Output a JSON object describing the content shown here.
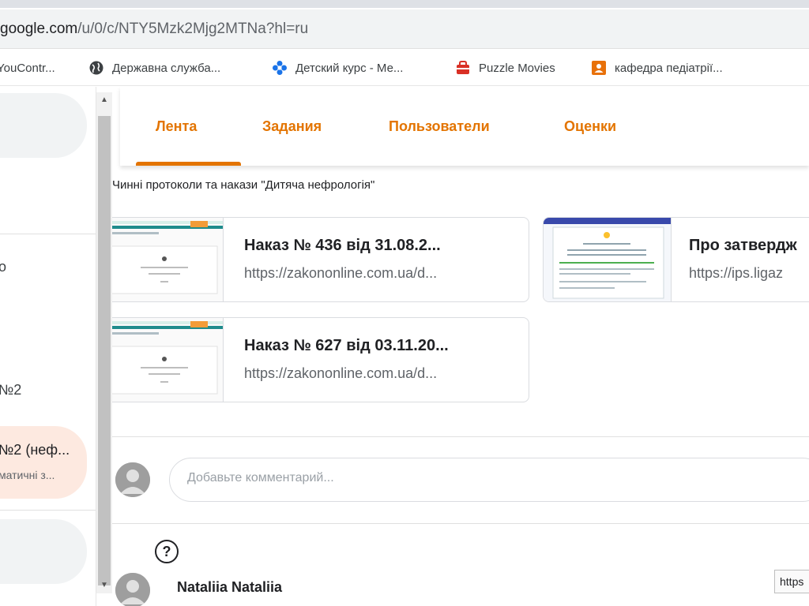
{
  "browser": {
    "url_host": "google.com",
    "url_host_prefix": "",
    "url_rest": "/u/0/c/NTY5Mzk2Mjg2MTNa?hl=ru",
    "bookmarks": [
      {
        "label": "YouContr...",
        "icon": "generic-icon"
      },
      {
        "label": "Державна служба...",
        "icon": "globe-icon"
      },
      {
        "label": "Детский курс - Ме...",
        "icon": "blue-flower-icon"
      },
      {
        "label": "Puzzle Movies",
        "icon": "red-bag-icon"
      },
      {
        "label": "кафедра педіатрії...",
        "icon": "orange-person-icon"
      }
    ]
  },
  "sidebar": {
    "item_partial_1": "о",
    "item_partial_2": "№2",
    "active_title": "№2 (неф...",
    "active_subtitle": "матичні з..."
  },
  "tabs": [
    "Лента",
    "Задания",
    "Пользователи",
    "Оценки"
  ],
  "post": {
    "title": "Чинні протоколи та накази \"Дитяча нефрологія\"",
    "links": [
      {
        "title": "Наказ № 436 від 31.08.2...",
        "url": "https://zakononline.com.ua/d..."
      },
      {
        "title": "Про затвердж",
        "url": "https://ips.ligaz"
      },
      {
        "title": "Наказ № 627 від 03.11.20...",
        "url": "https://zakononline.com.ua/d..."
      }
    ]
  },
  "comment": {
    "placeholder": "Добавьте комментарий..."
  },
  "next_post": {
    "author": "Nataliia Nataliia"
  },
  "tooltip": {
    "text": "https"
  },
  "colors": {
    "accent": "#e37400",
    "active_bg": "#fde9e0",
    "teal": "#1e8c8c"
  }
}
